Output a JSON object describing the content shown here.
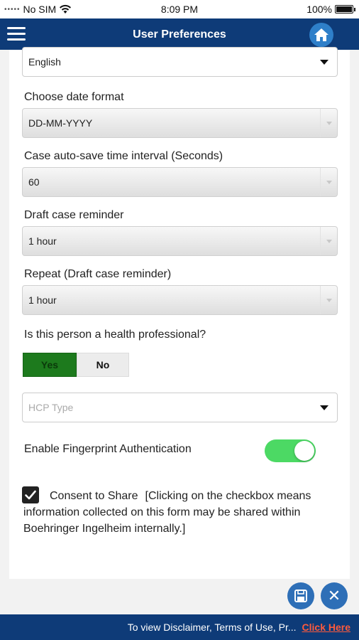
{
  "status_bar": {
    "carrier": "No SIM",
    "time": "8:09 PM",
    "battery": "100%"
  },
  "header": {
    "title": "User Preferences"
  },
  "form": {
    "language_value": "English",
    "date_format_label": "Choose date format",
    "date_format_value": "DD-MM-YYYY",
    "autosave_label": "Case auto-save time interval (Seconds)",
    "autosave_value": "60",
    "draft_label": "Draft case reminder",
    "draft_value": "1 hour",
    "repeat_label": "Repeat (Draft case reminder)",
    "repeat_value": "1 hour",
    "hcp_question": "Is this person a health professional?",
    "yes_label": "Yes",
    "no_label": "No",
    "hcp_type_placeholder": "HCP Type",
    "fingerprint_label": "Enable Fingerprint Authentication",
    "fingerprint_enabled": true,
    "consent_title": "Consent to Share",
    "consent_text": "[Clicking on the checkbox means information collected on this form may be shared within Boehringer Ingelheim internally.]",
    "consent_checked": true
  },
  "footer": {
    "text": "To view Disclaimer, Terms of Use, Pr...",
    "link": "Click Here"
  },
  "colors": {
    "header_bg": "#0e3b78",
    "accent_blue": "#2e6fb7",
    "yes_green": "#1d7a1d",
    "toggle_green": "#4cd964",
    "link_red": "#ff5a3c"
  }
}
